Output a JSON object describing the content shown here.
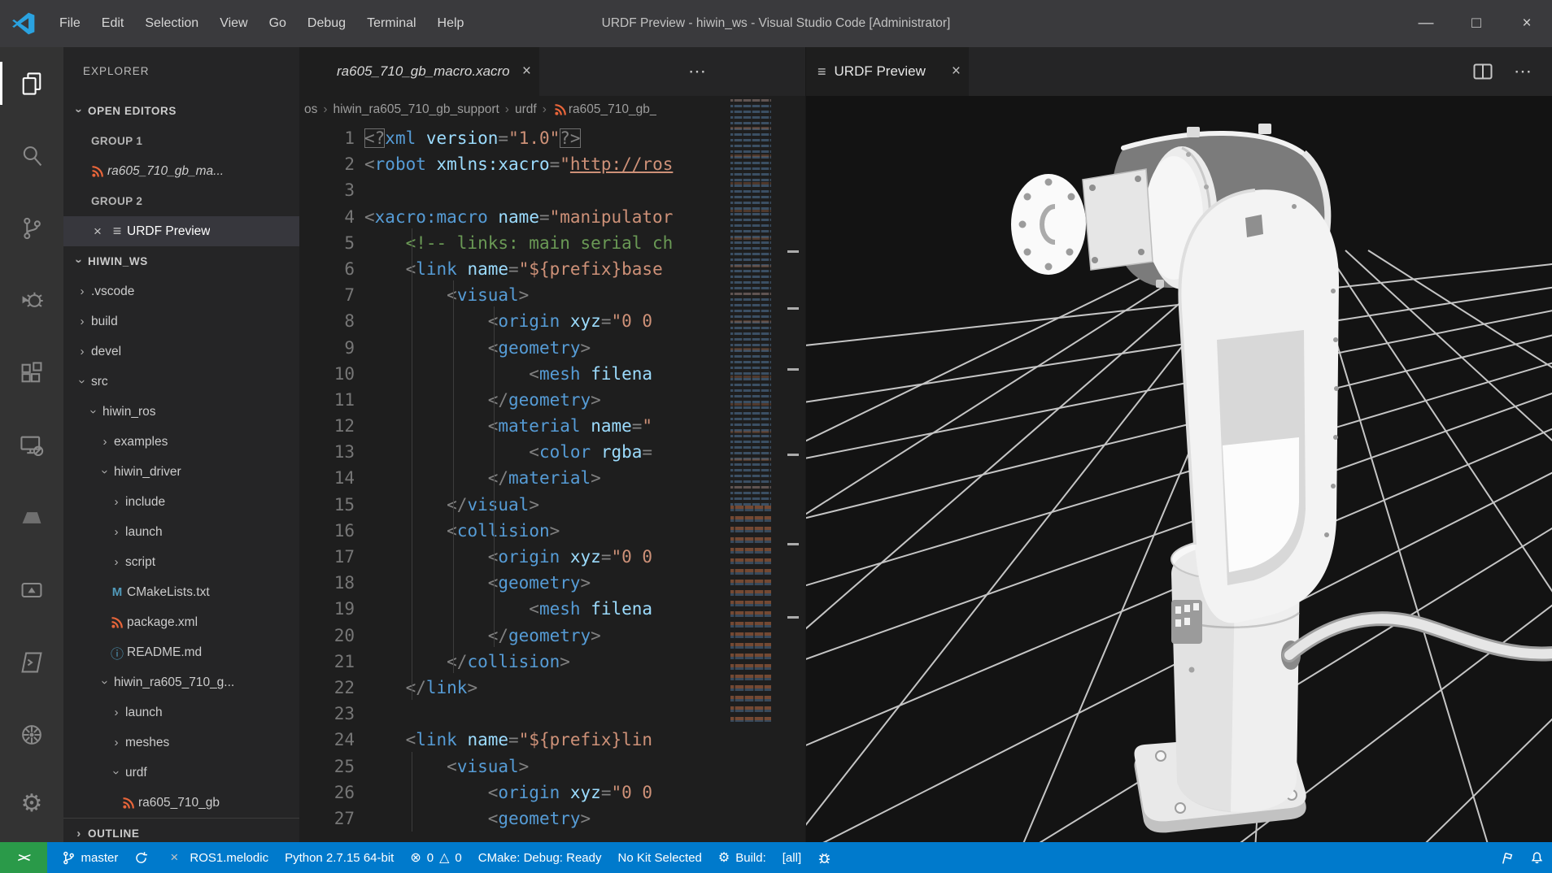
{
  "title_bar": {
    "title": "URDF Preview - hiwin_ws - Visual Studio Code [Administrator]",
    "menus": [
      "File",
      "Edit",
      "Selection",
      "View",
      "Go",
      "Debug",
      "Terminal",
      "Help"
    ],
    "window_controls": {
      "minimize": "—",
      "maximize": "□",
      "close": "×"
    }
  },
  "sidebar": {
    "title": "EXPLORER",
    "open_editors_label": "OPEN EDITORS",
    "open_editors": [
      {
        "kind": "group",
        "label": "GROUP 1"
      },
      {
        "kind": "file",
        "label": "ra605_710_gb_ma...",
        "icon": "xacro",
        "italic": true
      },
      {
        "kind": "group",
        "label": "GROUP 2"
      },
      {
        "kind": "file",
        "label": "URDF Preview",
        "icon": "preview",
        "close": true,
        "active": true
      }
    ],
    "workspace_label": "HIWIN_WS",
    "tree": [
      {
        "label": ".vscode",
        "ind": 0,
        "arrow": "closed"
      },
      {
        "label": "build",
        "ind": 0,
        "arrow": "closed"
      },
      {
        "label": "devel",
        "ind": 0,
        "arrow": "closed"
      },
      {
        "label": "src",
        "ind": 0,
        "arrow": "open"
      },
      {
        "label": "hiwin_ros",
        "ind": 1,
        "arrow": "open"
      },
      {
        "label": "examples",
        "ind": 2,
        "arrow": "closed"
      },
      {
        "label": "hiwin_driver",
        "ind": 2,
        "arrow": "open"
      },
      {
        "label": "include",
        "ind": 3,
        "arrow": "closed"
      },
      {
        "label": "launch",
        "ind": 3,
        "arrow": "closed"
      },
      {
        "label": "script",
        "ind": 3,
        "arrow": "closed"
      },
      {
        "label": "CMakeLists.txt",
        "ind": 3,
        "icon": "cmake"
      },
      {
        "label": "package.xml",
        "ind": 3,
        "icon": "xacro"
      },
      {
        "label": "README.md",
        "ind": 3,
        "icon": "info"
      },
      {
        "label": "hiwin_ra605_710_g...",
        "ind": 2,
        "arrow": "open"
      },
      {
        "label": "launch",
        "ind": 3,
        "arrow": "closed"
      },
      {
        "label": "meshes",
        "ind": 3,
        "arrow": "closed"
      },
      {
        "label": "urdf",
        "ind": 3,
        "arrow": "open"
      },
      {
        "label": "ra605_710_gb",
        "ind": 4,
        "icon": "xacro"
      }
    ],
    "outline_label": "OUTLINE"
  },
  "editor": {
    "tab_label": "ra605_710_gb_macro.xacro",
    "breadcrumb": [
      {
        "label": "os"
      },
      {
        "label": "hiwin_ra605_710_gb_support"
      },
      {
        "label": "urdf"
      },
      {
        "label": "ra605_710_gb_",
        "icon": "xacro"
      }
    ],
    "lines": [
      {
        "n": 1,
        "seg": [
          [
            "p match",
            "<?"
          ],
          [
            "tag",
            "xml"
          ],
          [
            "t",
            " "
          ],
          [
            "attr",
            "version"
          ],
          [
            "p",
            "="
          ],
          [
            "str",
            "\"1.0\""
          ],
          [
            "p match",
            "?>"
          ]
        ]
      },
      {
        "n": 2,
        "seg": [
          [
            "p",
            "<"
          ],
          [
            "tag",
            "robot"
          ],
          [
            "t",
            " "
          ],
          [
            "attr",
            "xmlns:xacro"
          ],
          [
            "p",
            "="
          ],
          [
            "str",
            "\""
          ],
          [
            "link",
            "http://ros"
          ]
        ]
      },
      {
        "n": 3,
        "seg": []
      },
      {
        "n": 4,
        "seg": [
          [
            "p",
            "<"
          ],
          [
            "tag",
            "xacro:macro"
          ],
          [
            "t",
            " "
          ],
          [
            "attr",
            "name"
          ],
          [
            "p",
            "="
          ],
          [
            "str",
            "\"manipulator"
          ]
        ]
      },
      {
        "n": 5,
        "seg": [
          [
            "t",
            "    "
          ],
          [
            "com",
            "<!-- links: main serial ch"
          ]
        ]
      },
      {
        "n": 6,
        "seg": [
          [
            "t",
            "    "
          ],
          [
            "p",
            "<"
          ],
          [
            "tag",
            "link"
          ],
          [
            "t",
            " "
          ],
          [
            "attr",
            "name"
          ],
          [
            "p",
            "="
          ],
          [
            "str",
            "\"${prefix}base"
          ]
        ]
      },
      {
        "n": 7,
        "seg": [
          [
            "t",
            "        "
          ],
          [
            "p",
            "<"
          ],
          [
            "tag",
            "visual"
          ],
          [
            "p",
            ">"
          ]
        ]
      },
      {
        "n": 8,
        "seg": [
          [
            "t",
            "            "
          ],
          [
            "p",
            "<"
          ],
          [
            "tag",
            "origin"
          ],
          [
            "t",
            " "
          ],
          [
            "attr",
            "xyz"
          ],
          [
            "p",
            "="
          ],
          [
            "str",
            "\"0 0"
          ]
        ]
      },
      {
        "n": 9,
        "seg": [
          [
            "t",
            "            "
          ],
          [
            "p",
            "<"
          ],
          [
            "tag",
            "geometry"
          ],
          [
            "p",
            ">"
          ]
        ]
      },
      {
        "n": 10,
        "seg": [
          [
            "t",
            "                "
          ],
          [
            "p",
            "<"
          ],
          [
            "tag",
            "mesh"
          ],
          [
            "t",
            " "
          ],
          [
            "attr",
            "filena"
          ]
        ]
      },
      {
        "n": 11,
        "seg": [
          [
            "t",
            "            "
          ],
          [
            "p",
            "</"
          ],
          [
            "tag",
            "geometry"
          ],
          [
            "p",
            ">"
          ]
        ]
      },
      {
        "n": 12,
        "seg": [
          [
            "t",
            "            "
          ],
          [
            "p",
            "<"
          ],
          [
            "tag",
            "material"
          ],
          [
            "t",
            " "
          ],
          [
            "attr",
            "name"
          ],
          [
            "p",
            "="
          ],
          [
            "str",
            "\""
          ]
        ]
      },
      {
        "n": 13,
        "seg": [
          [
            "t",
            "                "
          ],
          [
            "p",
            "<"
          ],
          [
            "tag",
            "color"
          ],
          [
            "t",
            " "
          ],
          [
            "attr",
            "rgba"
          ],
          [
            "p",
            "="
          ]
        ]
      },
      {
        "n": 14,
        "seg": [
          [
            "t",
            "            "
          ],
          [
            "p",
            "</"
          ],
          [
            "tag",
            "material"
          ],
          [
            "p",
            ">"
          ]
        ]
      },
      {
        "n": 15,
        "seg": [
          [
            "t",
            "        "
          ],
          [
            "p",
            "</"
          ],
          [
            "tag",
            "visual"
          ],
          [
            "p",
            ">"
          ]
        ]
      },
      {
        "n": 16,
        "seg": [
          [
            "t",
            "        "
          ],
          [
            "p",
            "<"
          ],
          [
            "tag",
            "collision"
          ],
          [
            "p",
            ">"
          ]
        ]
      },
      {
        "n": 17,
        "seg": [
          [
            "t",
            "            "
          ],
          [
            "p",
            "<"
          ],
          [
            "tag",
            "origin"
          ],
          [
            "t",
            " "
          ],
          [
            "attr",
            "xyz"
          ],
          [
            "p",
            "="
          ],
          [
            "str",
            "\"0 0"
          ]
        ]
      },
      {
        "n": 18,
        "seg": [
          [
            "t",
            "            "
          ],
          [
            "p",
            "<"
          ],
          [
            "tag",
            "geometry"
          ],
          [
            "p",
            ">"
          ]
        ]
      },
      {
        "n": 19,
        "seg": [
          [
            "t",
            "                "
          ],
          [
            "p",
            "<"
          ],
          [
            "tag",
            "mesh"
          ],
          [
            "t",
            " "
          ],
          [
            "attr",
            "filena"
          ]
        ]
      },
      {
        "n": 20,
        "seg": [
          [
            "t",
            "            "
          ],
          [
            "p",
            "</"
          ],
          [
            "tag",
            "geometry"
          ],
          [
            "p",
            ">"
          ]
        ]
      },
      {
        "n": 21,
        "seg": [
          [
            "t",
            "        "
          ],
          [
            "p",
            "</"
          ],
          [
            "tag",
            "collision"
          ],
          [
            "p",
            ">"
          ]
        ]
      },
      {
        "n": 22,
        "seg": [
          [
            "t",
            "    "
          ],
          [
            "p",
            "</"
          ],
          [
            "tag",
            "link"
          ],
          [
            "p",
            ">"
          ]
        ]
      },
      {
        "n": 23,
        "seg": []
      },
      {
        "n": 24,
        "seg": [
          [
            "t",
            "    "
          ],
          [
            "p",
            "<"
          ],
          [
            "tag",
            "link"
          ],
          [
            "t",
            " "
          ],
          [
            "attr",
            "name"
          ],
          [
            "p",
            "="
          ],
          [
            "str",
            "\"${prefix}lin"
          ]
        ]
      },
      {
        "n": 25,
        "seg": [
          [
            "t",
            "        "
          ],
          [
            "p",
            "<"
          ],
          [
            "tag",
            "visual"
          ],
          [
            "p",
            ">"
          ]
        ]
      },
      {
        "n": 26,
        "seg": [
          [
            "t",
            "            "
          ],
          [
            "p",
            "<"
          ],
          [
            "tag",
            "origin"
          ],
          [
            "t",
            " "
          ],
          [
            "attr",
            "xyz"
          ],
          [
            "p",
            "="
          ],
          [
            "str",
            "\"0 0"
          ]
        ]
      },
      {
        "n": 27,
        "seg": [
          [
            "t",
            "            "
          ],
          [
            "p",
            "<"
          ],
          [
            "tag",
            "geometry"
          ],
          [
            "p",
            ">"
          ]
        ]
      }
    ]
  },
  "preview": {
    "tab_label": "URDF Preview",
    "scene": "white 6-axis robot arm on perspective floor grid"
  },
  "status_bar": {
    "left": [
      {
        "name": "remote-indicator",
        "icon": "remote",
        "green": true
      },
      {
        "name": "git-branch",
        "icon": "branch",
        "label": "master"
      },
      {
        "name": "sync-button",
        "icon": "sync"
      },
      {
        "name": "ros-version",
        "icon": "close",
        "label": "ROS1.melodic"
      },
      {
        "name": "python-interpreter",
        "label": "Python 2.7.15 64-bit"
      },
      {
        "name": "problems",
        "icon": "error",
        "label": "0",
        "icon2": "warning",
        "label2": "0"
      },
      {
        "name": "cmake-status",
        "label": "CMake: Debug: Ready"
      },
      {
        "name": "cmake-kit",
        "label": "No Kit Selected"
      },
      {
        "name": "cmake-build",
        "icon": "gear",
        "label": "Build:"
      },
      {
        "name": "cmake-target",
        "label": "[all]"
      },
      {
        "name": "cmake-debug",
        "icon": "bug"
      }
    ],
    "right": [
      {
        "name": "feedback",
        "icon": "feedback"
      },
      {
        "name": "notifications",
        "icon": "bell"
      }
    ]
  },
  "colors": {
    "status_bar": "#007acc",
    "remote_green": "#2a9a49",
    "xacro_orange": "#e8653a",
    "tag_blue": "#569cd6",
    "attr_blue": "#9cdcfe",
    "string_orange": "#ce9178",
    "comment_green": "#6a9955",
    "viewport_bg": "#131313"
  }
}
